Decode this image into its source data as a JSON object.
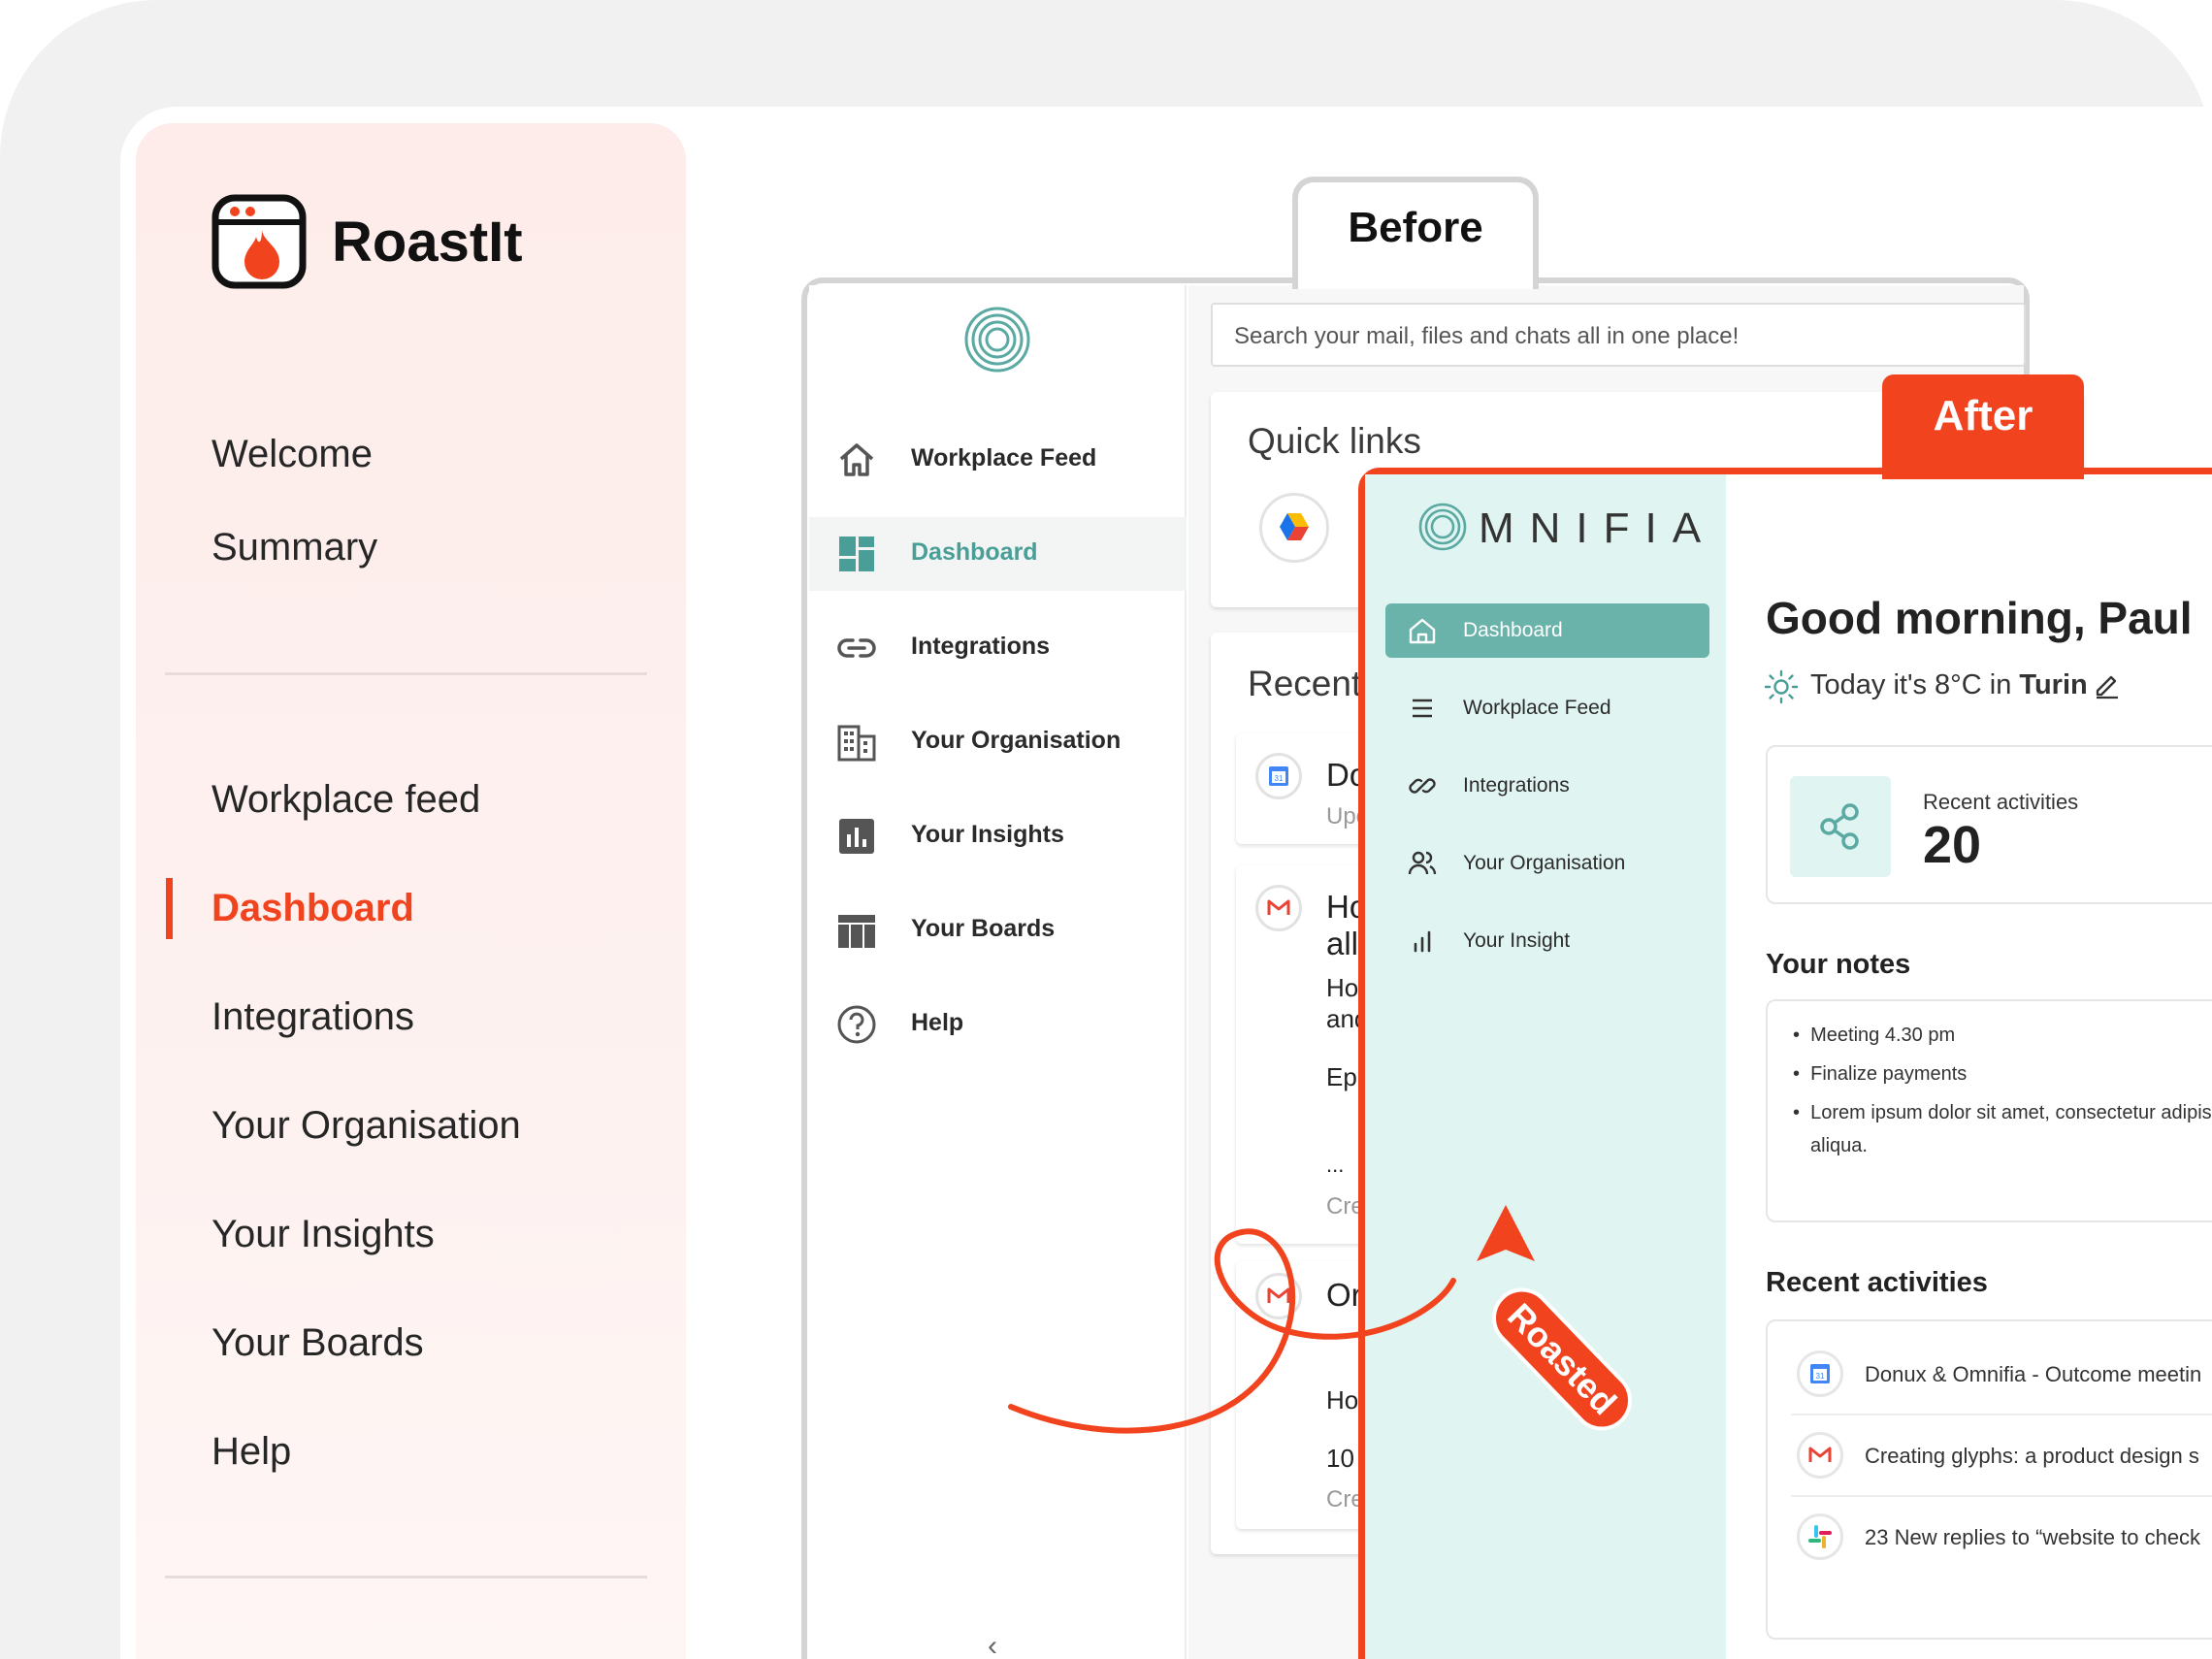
{
  "brand": {
    "name": "RoastIt",
    "accent": "#f2431f"
  },
  "left_nav": {
    "top_items": [
      "Welcome",
      "Summary"
    ],
    "items": [
      "Workplace feed",
      "Dashboard",
      "Integrations",
      "Your Organisation",
      "Your Insights",
      "Your Boards",
      "Help"
    ],
    "active": "Dashboard"
  },
  "before": {
    "tab_label": "Before",
    "nav": [
      {
        "label": "Workplace Feed",
        "icon": "home-icon"
      },
      {
        "label": "Dashboard",
        "icon": "dashboard-grid-icon",
        "active": true
      },
      {
        "label": "Integrations",
        "icon": "link-icon"
      },
      {
        "label": "Your Organisation",
        "icon": "building-icon"
      },
      {
        "label": "Your Insights",
        "icon": "bar-chart-icon"
      },
      {
        "label": "Your Boards",
        "icon": "board-icon"
      },
      {
        "label": "Help",
        "icon": "help-circle-icon"
      }
    ],
    "search_placeholder": "Search your mail, files and chats all in one place!",
    "quick_links_title": "Quick links",
    "recent_title": "Recent",
    "feed_fragments": [
      "Do",
      "Upc",
      "Ho",
      "all",
      "Ho",
      "and",
      "Epi",
      "...",
      "Cre",
      "Or",
      "Ho",
      "10",
      "Cre"
    ],
    "collapse_glyph": "‹",
    "sidebar_accent": "#4a9e98"
  },
  "after": {
    "tab_label": "After",
    "logo_text": "MNIFIA",
    "nav": [
      {
        "label": "Dashboard",
        "icon": "home-icon",
        "active": true
      },
      {
        "label": "Workplace Feed",
        "icon": "menu-lines-icon"
      },
      {
        "label": "Integrations",
        "icon": "link-icon"
      },
      {
        "label": "Your Organisation",
        "icon": "people-icon"
      },
      {
        "label": "Your Insight",
        "icon": "bar-chart-icon"
      }
    ],
    "greeting": "Good morning, Paul",
    "weather_prefix": "Today it's 8°C in",
    "weather_city": "Turin",
    "stat_label": "Recent activities",
    "stat_value": "20",
    "notes_title": "Your notes",
    "notes": [
      "Meeting 4.30 pm",
      "Finalize payments",
      "Lorem ipsum dolor sit amet, consectetur adipis"
    ],
    "notes_continuation": "aliqua.",
    "activities_title": "Recent activities",
    "activities": [
      {
        "icon": "calendar-icon",
        "text": "Donux & Omnifia  - Outcome meetin"
      },
      {
        "icon": "gmail-icon",
        "text": "Creating glyphs: a product design s"
      },
      {
        "icon": "slack-icon",
        "text": "23 New replies to “website to check"
      }
    ],
    "sidebar_bg": "#e0f4f1",
    "active_bg": "#6ab3aa"
  },
  "annotation": {
    "badge_text": "Roasted"
  }
}
